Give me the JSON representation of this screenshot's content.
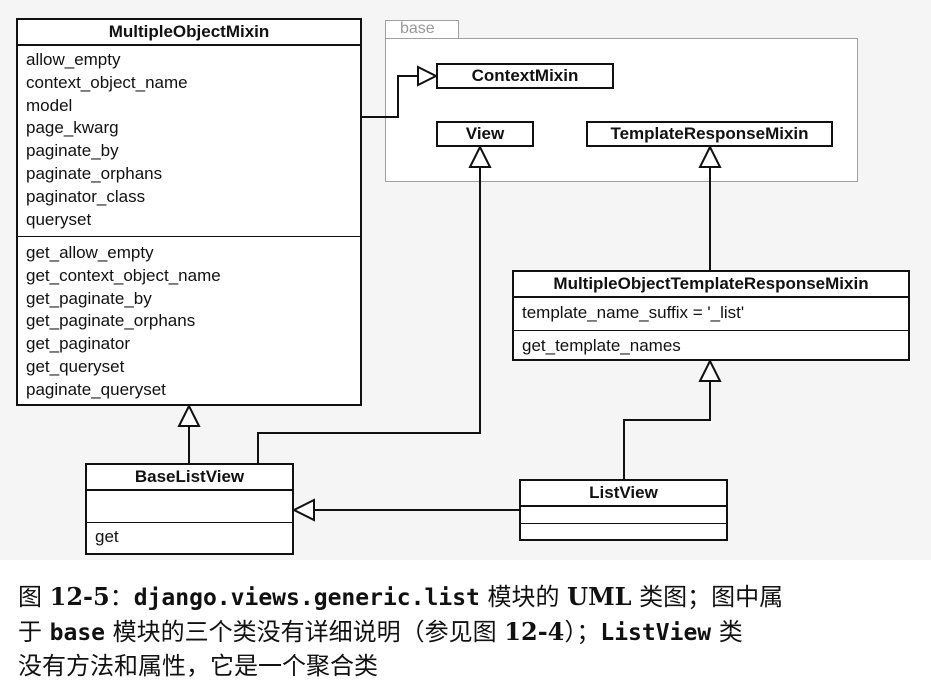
{
  "package": {
    "name": "base"
  },
  "classes": {
    "multiple_object_mixin": {
      "name": "MultipleObjectMixin",
      "attributes": [
        "allow_empty",
        "context_object_name",
        "model",
        "page_kwarg",
        "paginate_by",
        "paginate_orphans",
        "paginator_class",
        "queryset"
      ],
      "methods": [
        "get_allow_empty",
        "get_context_object_name",
        "get_paginate_by",
        "get_paginate_orphans",
        "get_paginator",
        "get_queryset",
        "paginate_queryset"
      ]
    },
    "context_mixin": {
      "name": "ContextMixin"
    },
    "view": {
      "name": "View"
    },
    "template_response_mixin": {
      "name": "TemplateResponseMixin"
    },
    "multiple_object_template_response_mixin": {
      "name": "MultipleObjectTemplateResponseMixin",
      "attributes": [
        "template_name_suffix = '_list'"
      ],
      "methods": [
        "get_template_names"
      ]
    },
    "base_list_view": {
      "name": "BaseListView",
      "attributes": [],
      "methods": [
        "get"
      ]
    },
    "list_view": {
      "name": "ListView",
      "attributes": [],
      "methods": []
    }
  },
  "caption": {
    "t1": "图 ",
    "t2": "12-5",
    "t3": "：",
    "t4": "django.views.generic.list",
    "t5": " 模块的 ",
    "t6": "UML",
    "t7": " 类图；图中属",
    "t8": "于 ",
    "t9": "base",
    "t10": " 模块的三个类没有详细说明（参见图 ",
    "t11": "12-4",
    "t12": "）；",
    "t13": "ListView",
    "t14": " 类",
    "t15": "没有方法和属性，它是一个聚合类"
  }
}
